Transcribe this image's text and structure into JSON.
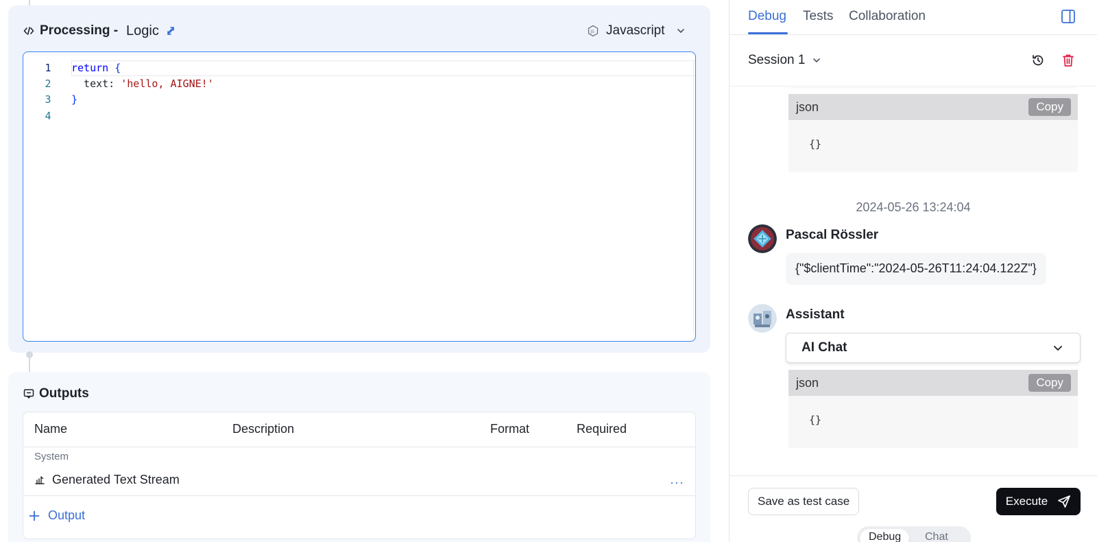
{
  "processing": {
    "title": "Processing -",
    "subtitle": "Logic",
    "language": "Javascript"
  },
  "editor": {
    "line_numbers": [
      "1",
      "2",
      "3",
      "4"
    ],
    "lines": [
      {
        "kw": "return",
        "rest": " {"
      },
      {
        "key": "  text: ",
        "str": "'hello, AIGNE!'"
      },
      {
        "close": "}"
      },
      {
        "empty": ""
      }
    ]
  },
  "outputs": {
    "title": "Outputs",
    "columns": [
      "Name",
      "Description",
      "Format",
      "Required"
    ],
    "group_label": "System",
    "rows": [
      {
        "name": "Generated Text Stream"
      }
    ],
    "add_label": "Output"
  },
  "right_panel": {
    "tabs": [
      {
        "label": "Debug",
        "active": true
      },
      {
        "label": "Tests",
        "active": false
      },
      {
        "label": "Collaboration",
        "active": false
      }
    ],
    "session_label": "Session 1",
    "messages": {
      "json_block_1": {
        "label": "json",
        "copy": "Copy",
        "body": "{}"
      },
      "timestamp": "2024-05-26 13:24:04",
      "user_name": "Pascal Rössler",
      "user_message": "{\"$clientTime\":\"2024-05-26T11:24:04.122Z\"}",
      "assistant_name": "Assistant",
      "agent_select": "AI Chat",
      "json_block_2": {
        "label": "json",
        "copy": "Copy",
        "body": "{}"
      }
    },
    "footer": {
      "save_button": "Save as test case",
      "execute_button": "Execute",
      "mode_options": [
        "Debug",
        "Chat"
      ]
    }
  },
  "colors": {
    "accent": "#3b6fd6",
    "danger": "#e11d48",
    "execute_bg": "#0d0f14"
  }
}
